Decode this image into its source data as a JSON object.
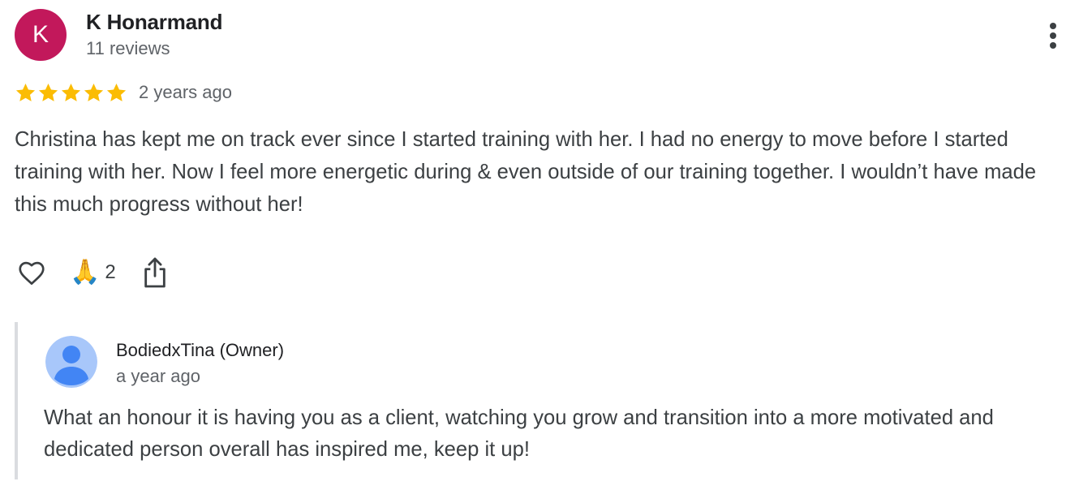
{
  "review": {
    "author": {
      "initial": "K",
      "name": "K Honarmand",
      "meta": "11 reviews",
      "avatar_color": "#c2185b"
    },
    "rating": 5,
    "max_rating": 5,
    "star_color": "#fbbc04",
    "time": "2 years ago",
    "text": "Christina has kept me on track ever since I started training with her. I had no energy to move before I started training with her. Now I feel more energetic during & even outside of our training together. I wouldn’t have made this much progress without her!",
    "actions": {
      "like_icon": "heart-outline-icon",
      "reaction_emoji": "🙏",
      "reaction_count": "2",
      "share_icon": "share-icon"
    },
    "more_icon": "more-vertical-icon"
  },
  "owner_reply": {
    "name": "BodiedxTina (Owner)",
    "time": "a year ago",
    "text": "What an honour it is having you as a client, watching you grow and transition into a more motivated and dedicated person overall has inspired me, keep it up!",
    "avatar_icon": "default-person-avatar-icon",
    "avatar_bg": "#a8c7fa",
    "avatar_fg": "#4285f4"
  }
}
